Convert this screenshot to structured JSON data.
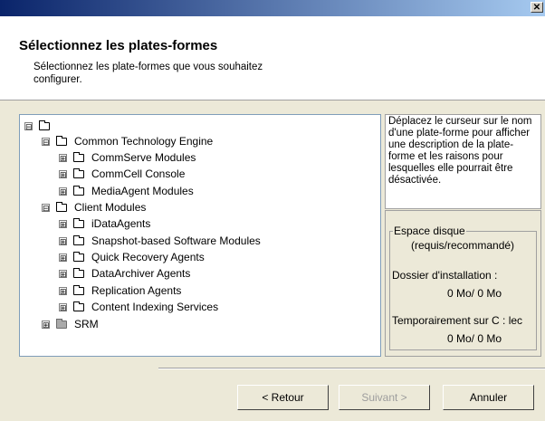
{
  "window": {
    "close_glyph": "✕"
  },
  "header": {
    "title": "Sélectionnez les plates-formes",
    "subtitle": "Sélectionnez les plate-formes que vous souhaitez configurer."
  },
  "tree": {
    "root": {
      "expander": "⊟",
      "label": ""
    },
    "items": [
      {
        "label": "Common Technology Engine",
        "expander": "⊟"
      },
      {
        "label": "CommServe Modules",
        "expander": "⊞"
      },
      {
        "label": "CommCell Console",
        "expander": "⊞"
      },
      {
        "label": "MediaAgent Modules",
        "expander": "⊞"
      },
      {
        "label": "Client Modules",
        "expander": "⊟"
      },
      {
        "label": "iDataAgents",
        "expander": "⊞"
      },
      {
        "label": "Snapshot-based Software Modules",
        "expander": "⊞"
      },
      {
        "label": "Quick Recovery Agents",
        "expander": "⊞"
      },
      {
        "label": "DataArchiver Agents",
        "expander": "⊞"
      },
      {
        "label": "Replication Agents",
        "expander": "⊞"
      },
      {
        "label": "Content Indexing Services",
        "expander": "⊞"
      },
      {
        "label": "SRM",
        "expander": "⊞"
      }
    ]
  },
  "info": {
    "text": "Déplacez le curseur sur le nom d'une plate-forme pour afficher une description de la plate-forme et les raisons pour lesquelles elle pourrait être désactivée."
  },
  "disk_space": {
    "legend": "Espace disque",
    "subtitle": "(requis/recommandé)",
    "install_label": "Dossier d'installation :",
    "install_value": "0 Mo/ 0 Mo",
    "temp_label": "Temporairement sur C : lec",
    "temp_value": "0 Mo/ 0 Mo"
  },
  "buttons": {
    "back": "< Retour",
    "next": "Suivant >",
    "cancel": "Annuler"
  }
}
